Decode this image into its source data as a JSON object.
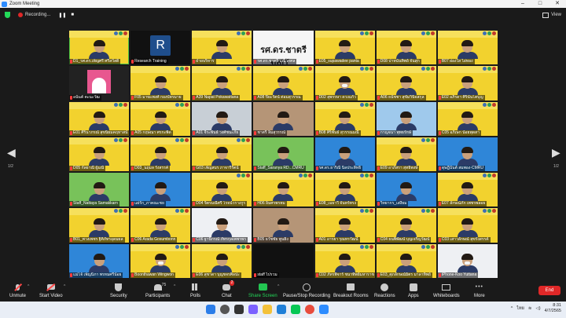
{
  "window": {
    "title": "Zoom Meeting",
    "minimize": "–",
    "maximize": "□",
    "close": "✕"
  },
  "topbar": {
    "recording_label": "Recording...",
    "pause_symbol": "❚❚",
    "stop_symbol": "■",
    "view_label": "View"
  },
  "pagination": {
    "left_page": "1/2",
    "right_page": "1/2"
  },
  "participants": [
    {
      "name": "D1_รศ.ดร.เพ็ญศรี ศรีสวัสดิ์",
      "bg": "title-yellow",
      "active": true
    },
    {
      "name": "Research Training",
      "bg": "letter",
      "letter": "R"
    },
    {
      "name": "ฝ่ายบริหาร",
      "bg": "yellow"
    },
    {
      "name": "รศ.ดร.ชาตรี มณีโกศล",
      "bg": "title",
      "title_text": "รศ.ดร.ชาตรี มณีโ..."
    },
    {
      "name": "E05_supawadee panta",
      "bg": "yellow"
    },
    {
      "name": "D08 ปาหนันทิพย์ จันสุก",
      "bg": "yellow"
    },
    {
      "name": "B07 ผ่องใส ไผ่ทอง",
      "bg": "yellow"
    },
    {
      "name": "อนันต์ ตะนะวัฒ",
      "bg": "pinkbox"
    },
    {
      "name": "F05 มาฆะพงศ์ กองบัตรมาย",
      "bg": "yellow"
    },
    {
      "name": "A39 Napat Pokawattana",
      "bg": "yellow"
    },
    {
      "name": "A08 ปิยะรัตน์ ต่อมสุวรรณ",
      "bg": "yellow"
    },
    {
      "name": "D02 สุพรรษา ดวงแก้ว",
      "bg": "yellow",
      "mask": true
    },
    {
      "name": "A06 ธนัชชา สุขัมวินิจสกุล",
      "bg": "yellow"
    },
    {
      "name": "E02 อภิรดา ศิรินันโตบุญ",
      "bg": "yellow"
    },
    {
      "name": "E01 ศิรินาภรณ์ สุขนิยมคฤหาสน์",
      "bg": "yellow"
    },
    {
      "name": "A05 กฤษณา ศรกะพิด",
      "bg": "yellow"
    },
    {
      "name": "A01 จีระพันธ์ วงศ์ชนะภัย",
      "bg": "office"
    },
    {
      "name": "ชาตรี ลิ้มสุวรรณ์",
      "bg": "room"
    },
    {
      "name": "B08 ศิริพันธ์ สุวรรณมณี",
      "bg": "yellow"
    },
    {
      "name": "กาญจนา พุทธรักษ์",
      "bg": "lightblue"
    },
    {
      "name": "C05 อภิเษก น้อยพุดสา",
      "bg": "yellow"
    },
    {
      "name": "D05 กัลยาณี ผู้มณี",
      "bg": "yellow"
    },
    {
      "name": "D03_นฤมล รังสรรค์",
      "bg": "yellow"
    },
    {
      "name": "G03 เพ็ญสมร ภาจารีรัตน์",
      "bg": "yellow"
    },
    {
      "name": "Staff_Saranya RD...CMRU",
      "bg": "green"
    },
    {
      "name": "รศ.ดร.ธาริณี นิลประสิทธิ์",
      "bg": "blue"
    },
    {
      "name": "E09 อาภัสรา สุทธิพงษ์",
      "bg": "yellow"
    },
    {
      "name": "ดุษฎีนันต์ สมพอง-CMRU",
      "bg": "blue"
    },
    {
      "name": "Staff_Nattaya Samakkarn",
      "bg": "green"
    },
    {
      "name": "แผ่รัก_ภาคณะชย",
      "bg": "blue"
    },
    {
      "name": "D04 จิตรมณีศรี โรจน์วรางกูร",
      "bg": "yellow"
    },
    {
      "name": "H06 อิ่มศรพรหม",
      "bg": "yellow"
    },
    {
      "name": "E08_เมธาวี จันทร์ทรง",
      "bg": "yellow"
    },
    {
      "name": "วิทยากร_เสงียม",
      "bg": "blue"
    },
    {
      "name": "E07 ลักษณ์ภัก เพชรพลอย",
      "bg": "yellow"
    },
    {
      "name": "B01_พวงเพชร ฐิติภัทรอุดมผล",
      "bg": "yellow"
    },
    {
      "name": "C06 Arada Gosumbonn",
      "bg": "yellow"
    },
    {
      "name": "C06 ฐานิกรณ์ ภัทรกุลเพชรพร",
      "bg": "white"
    },
    {
      "name": "B05 ธวัชชัย พูนยิ่ง",
      "bg": "room"
    },
    {
      "name": "A01 อารยา รุณทรวัฒน์",
      "bg": "yellow"
    },
    {
      "name": "C04 ธนพิพัฒน์ บุญเจริญวัฒน์",
      "bg": "yellow"
    },
    {
      "name": "C03 เสาวลักษณ์ สุขรังสรรค์",
      "bg": "yellow"
    },
    {
      "name": "แม่โจ้ เพ็ญนิภา พรหมศรีน้อย",
      "bg": "blue"
    },
    {
      "name": "Boonthawan Wingwon",
      "bg": "yellow",
      "mask": true
    },
    {
      "name": "E06 สุชาดา บุญขจรศิลปะ",
      "bg": "yellow"
    },
    {
      "name": "staff ไปรวม",
      "bg": "black"
    },
    {
      "name": "C02 ภัทรพิจาร์ ชนาทิพย์มหาราช",
      "bg": "yellow"
    },
    {
      "name": "E03_ศุภลักษณ์มิตร มาลาทิพย์",
      "bg": "yellow"
    },
    {
      "name": "iPhone-Koo Yuttana",
      "bg": "white",
      "mask": true
    }
  ],
  "toolbar": {
    "unmute": "Unmute",
    "start_video": "Start Video",
    "security": "Security",
    "participants": "Participants",
    "participant_count": "75",
    "polls": "Polls",
    "chat": "Chat",
    "chat_badge": "2",
    "share_screen": "Share Screen",
    "record": "Pause/Stop Recording",
    "breakout": "Breakout Rooms",
    "reactions": "Reactions",
    "apps": "Apps",
    "whiteboards": "Whiteboards",
    "more": "More",
    "end": "End"
  },
  "taskbar": {
    "lang": "ไทย",
    "time": "8:31",
    "date": "4/7/2565"
  },
  "colors": {
    "zoom_blue": "#2d8cff",
    "end_red": "#e02828",
    "share_green": "#23d959",
    "active_outline": "#4cc443"
  }
}
